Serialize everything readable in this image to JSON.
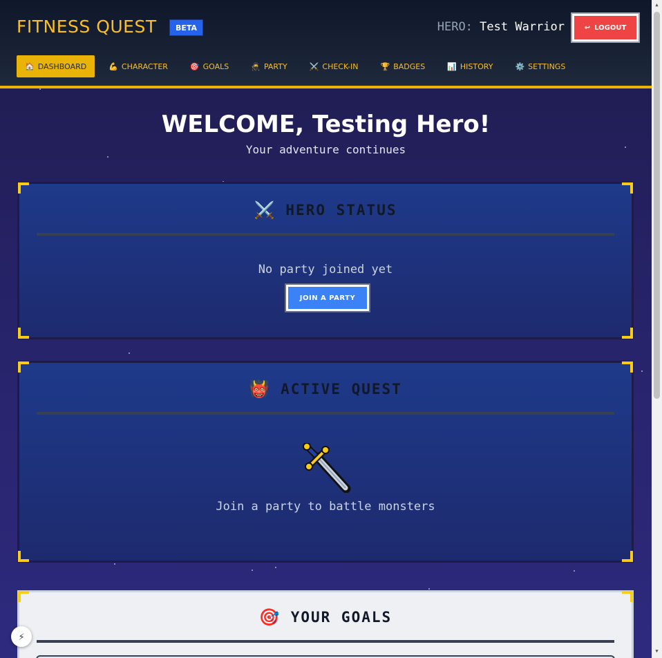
{
  "header": {
    "brand": "FITNESS QUEST",
    "beta": "BETA",
    "hero_label": "HERO:",
    "hero_name": "Test Warrior",
    "logout_label": "LOGOUT",
    "logout_icon": "↩"
  },
  "nav": [
    {
      "icon": "🏠",
      "label": "DASHBOARD",
      "active": true
    },
    {
      "icon": "💪",
      "label": "CHARACTER"
    },
    {
      "icon": "🎯",
      "label": "GOALS"
    },
    {
      "icon": "🥷",
      "label": "PARTY"
    },
    {
      "icon": "⚔️",
      "label": "CHECK-IN"
    },
    {
      "icon": "🏆",
      "label": "BADGES"
    },
    {
      "icon": "📊",
      "label": "HISTORY"
    },
    {
      "icon": "⚙️",
      "label": "SETTINGS"
    }
  ],
  "welcome": {
    "title": "WELCOME, Testing Hero!",
    "subtitle": "Your adventure continues"
  },
  "hero_status": {
    "icon": "⚔️",
    "title": "HERO STATUS",
    "message": "No party joined yet",
    "button": "JOIN A PARTY"
  },
  "active_quest": {
    "icon": "👹",
    "title": "ACTIVE QUEST",
    "message": "Join a party to battle monsters"
  },
  "goals": {
    "icon": "🎯",
    "title": "YOUR GOALS"
  },
  "colors": {
    "accent": "#eab308",
    "logout": "#ef4444",
    "primary_button": "#3b82f6"
  },
  "fab_icon": "⚡"
}
